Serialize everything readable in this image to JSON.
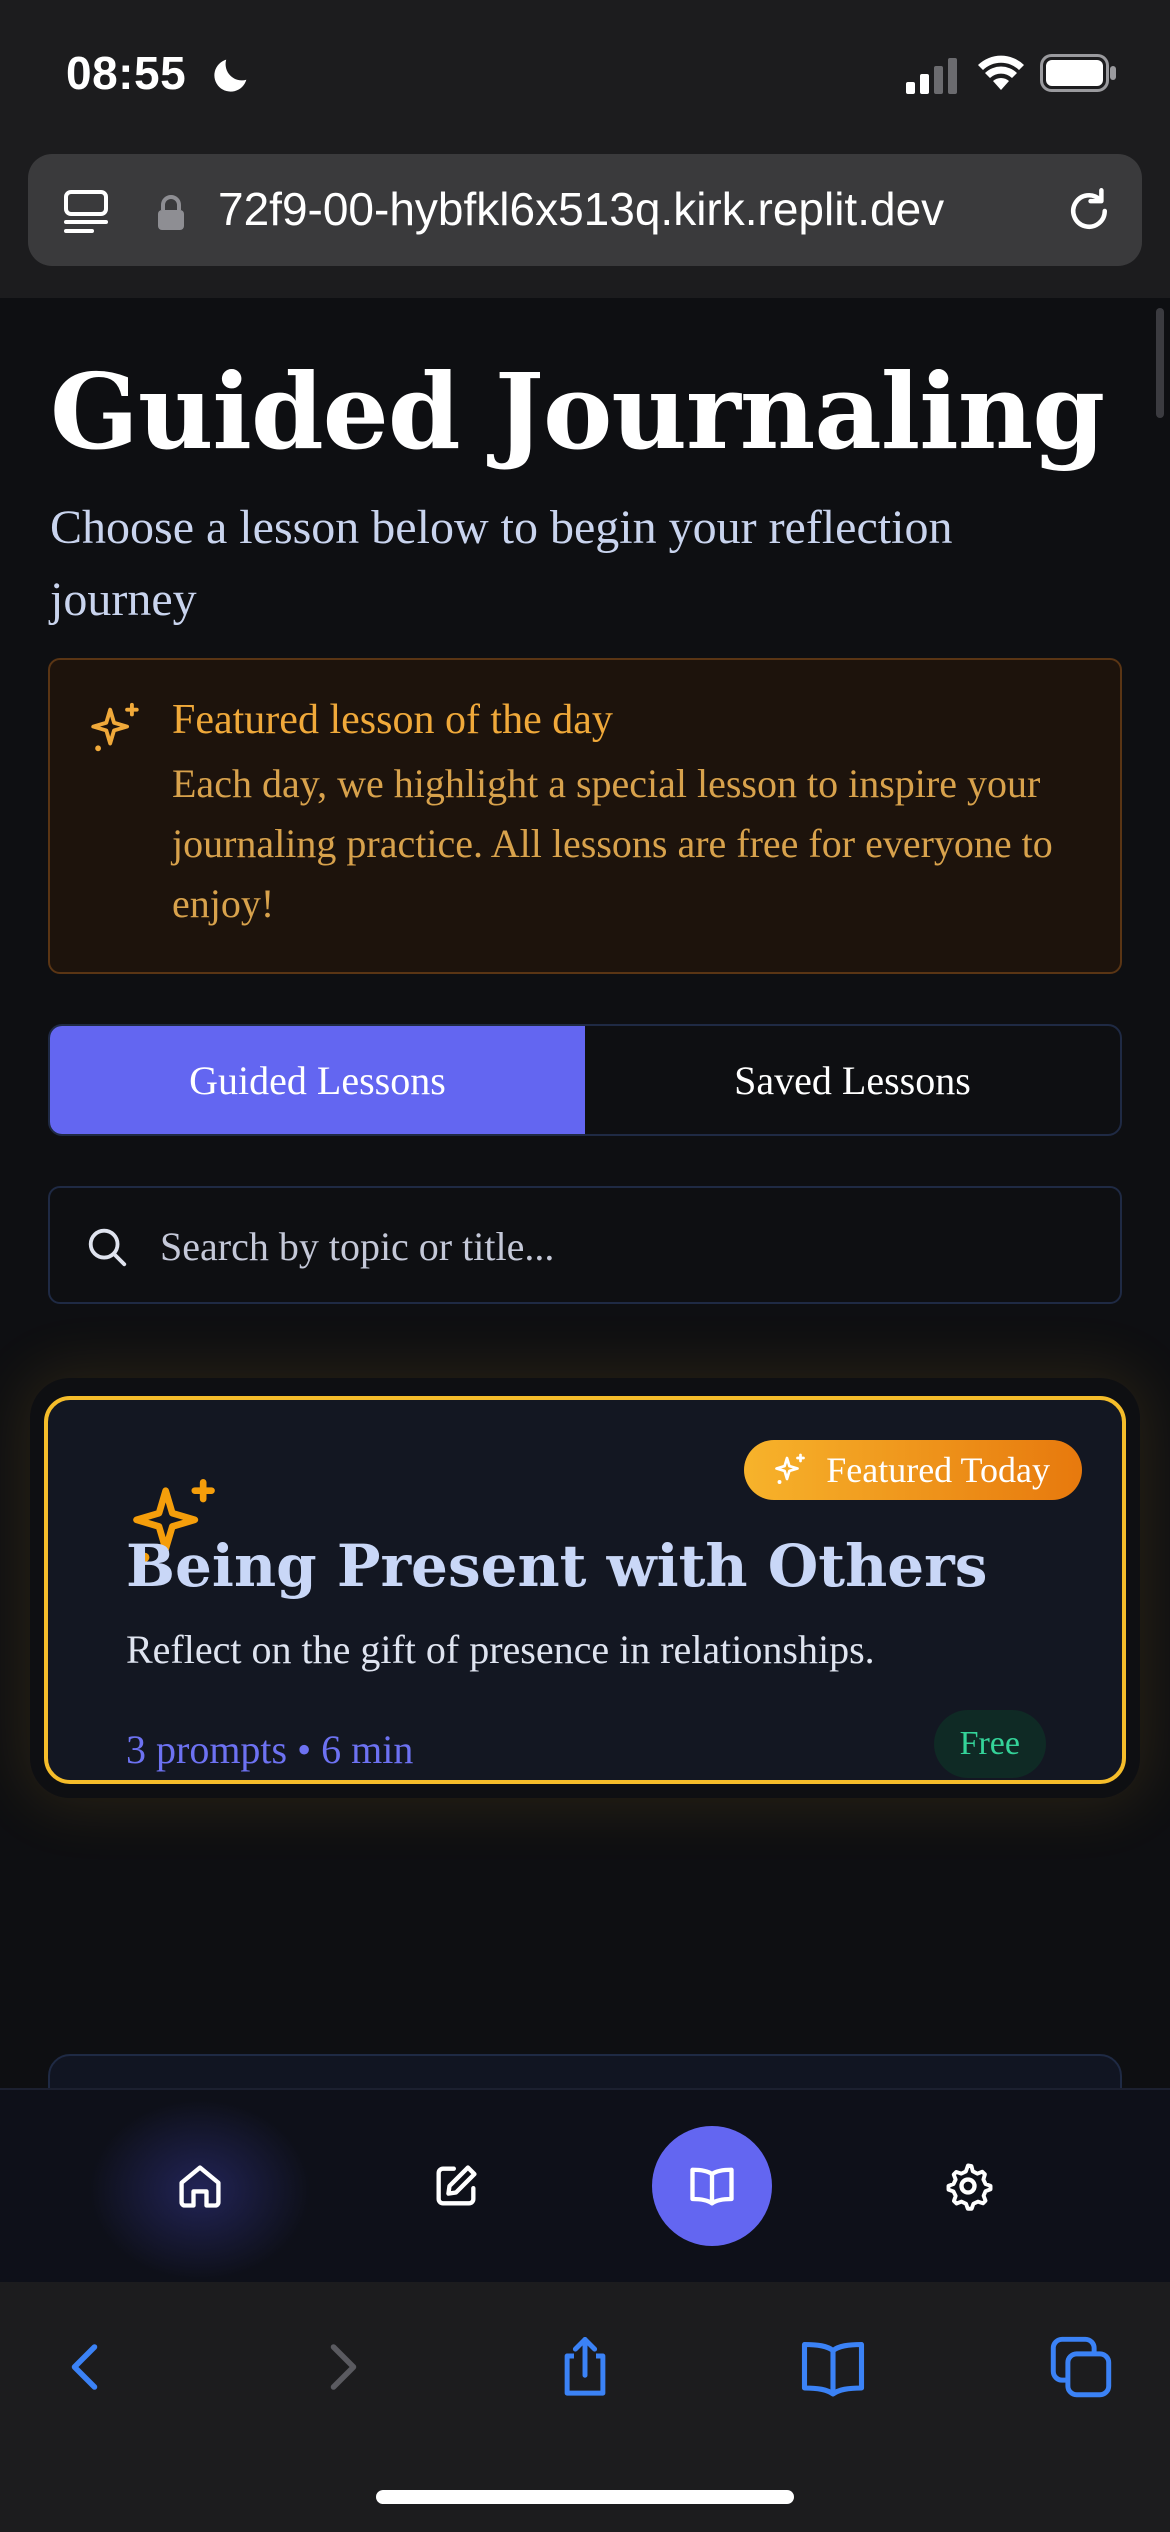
{
  "status_bar": {
    "time": "08:55"
  },
  "browser": {
    "url": "72f9-00-hybfkl6x513q.kirk.replit.dev"
  },
  "page": {
    "title": "Guided Journaling",
    "subtitle": "Choose a lesson below to begin your reflection journey"
  },
  "notice": {
    "title": "Featured lesson of the day",
    "body": "Each day, we highlight a special lesson to inspire your journaling practice. All lessons are free for everyone to enjoy!"
  },
  "tabs": [
    {
      "label": "Guided Lessons",
      "active": true
    },
    {
      "label": "Saved Lessons",
      "active": false
    }
  ],
  "search": {
    "placeholder": "Search by topic or title...",
    "value": ""
  },
  "featured_card": {
    "badge": "Featured Today",
    "title": "Being Present with Others",
    "description": "Reflect on the gift of presence in relationships.",
    "meta": "3 prompts • 6 min",
    "price": "Free"
  },
  "app_nav": {
    "items": [
      "home-icon",
      "edit-icon",
      "book-icon",
      "gear-icon"
    ],
    "active": "book-icon"
  },
  "colors": {
    "accent": "#6366f1",
    "featured_border": "#f5bd2a",
    "notice_text": "#f0a93a",
    "free_text": "#34d399"
  }
}
